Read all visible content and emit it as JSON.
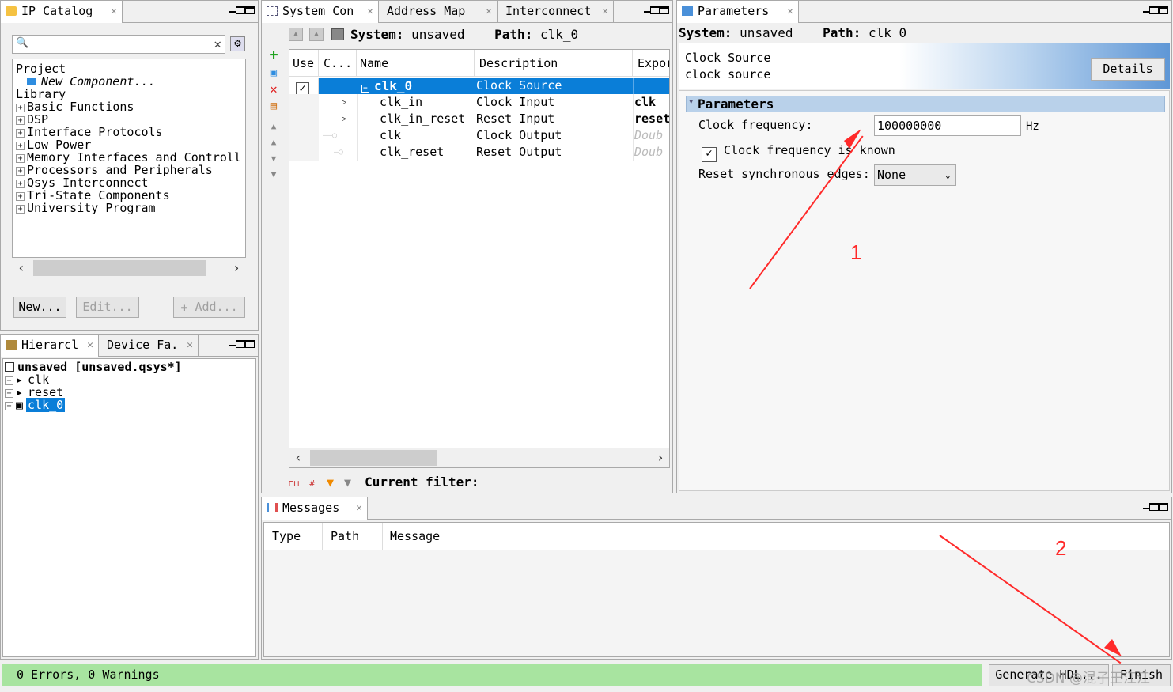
{
  "ip_catalog": {
    "tab_label": "IP Catalog",
    "search_placeholder": "",
    "tree": {
      "project": "Project",
      "new_component": "New Component...",
      "library": "Library",
      "items": [
        "Basic Functions",
        "DSP",
        "Interface Protocols",
        "Low Power",
        "Memory Interfaces and Controll",
        "Processors and Peripherals",
        "Qsys Interconnect",
        "Tri-State Components",
        "University Program"
      ]
    },
    "buttons": {
      "new": "New...",
      "edit": "Edit...",
      "add": "Add..."
    }
  },
  "hierarchy": {
    "tab_label": "Hierarcl",
    "tab2_label": "Device Fa.",
    "root": "unsaved [unsaved.qsys*]",
    "items": [
      "clk",
      "reset",
      "clk_0"
    ]
  },
  "system_contents": {
    "tabs": [
      "System Con",
      "Address Map",
      "Interconnect"
    ],
    "system_label": "System:",
    "system_value": "unsaved",
    "path_label": "Path:",
    "path_value": "clk_0",
    "columns": [
      "Use",
      "C...",
      "Name",
      "Description",
      "Expor"
    ],
    "rows": [
      {
        "use": true,
        "name": "clk_0",
        "description": "Clock Source",
        "export": "",
        "selected": true
      },
      {
        "use": false,
        "name": "clk_in",
        "description": "Clock Input",
        "export": "clk"
      },
      {
        "use": false,
        "name": "clk_in_reset",
        "description": "Reset Input",
        "export": "reset"
      },
      {
        "use": false,
        "name": "clk",
        "description": "Clock Output",
        "export": "Doub"
      },
      {
        "use": false,
        "name": "clk_reset",
        "description": "Reset Output",
        "export": "Doub"
      }
    ],
    "filter_label": "Current filter:"
  },
  "parameters": {
    "tab_label": "Parameters",
    "system_label": "System:",
    "system_value": "unsaved",
    "path_label": "Path:",
    "path_value": "clk_0",
    "component_title": "Clock Source",
    "component_name": "clock_source",
    "details_button": "Details",
    "section_title": "Parameters",
    "clock_frequency_label": "Clock frequency:",
    "clock_frequency_value": "100000000",
    "clock_frequency_unit": "Hz",
    "clock_known_label": "Clock frequency is known",
    "clock_known_checked": true,
    "reset_sync_label": "Reset synchronous edges:",
    "reset_sync_value": "None"
  },
  "messages": {
    "tab_label": "Messages",
    "columns": [
      "Type",
      "Path",
      "Message"
    ]
  },
  "status_bar": {
    "text": "0 Errors, 0 Warnings",
    "generate_button": "Generate HDL...",
    "finish_button": "Finish"
  },
  "annotations": {
    "label_1": "1",
    "label_2": "2",
    "color": "#ff2a2a"
  },
  "watermark": "CSDN @混子王江江"
}
